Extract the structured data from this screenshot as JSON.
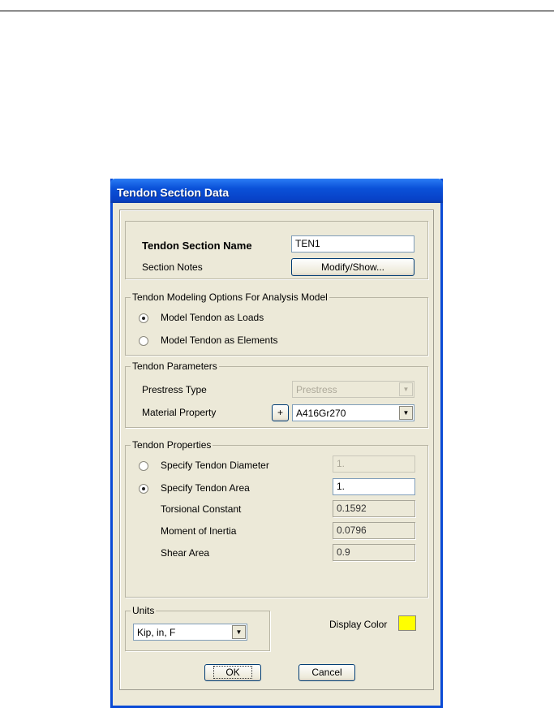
{
  "dialog": {
    "title": "Tendon Section Data",
    "section_name_label": "Tendon Section Name",
    "section_name_value": "TEN1",
    "section_notes_label": "Section Notes",
    "modify_show_label": "Modify/Show...",
    "modeling": {
      "legend": "Tendon Modeling Options For Analysis Model",
      "option_loads": "Model Tendon as Loads",
      "option_elements": "Model Tendon as Elements",
      "selected": "Model Tendon as Loads"
    },
    "parameters": {
      "legend": "Tendon Parameters",
      "prestress_type_label": "Prestress Type",
      "prestress_type_value": "Prestress",
      "material_property_label": "Material Property",
      "add_material_label": "+",
      "material_property_value": "A416Gr270"
    },
    "properties": {
      "legend": "Tendon Properties",
      "diameter_label": "Specify Tendon Diameter",
      "diameter_value": "1.",
      "area_label": "Specify Tendon Area",
      "area_value": "1.",
      "selected": "Specify Tendon Area",
      "torsional_label": "Torsional Constant",
      "torsional_value": "0.1592",
      "inertia_label": "Moment of Inertia",
      "inertia_value": "0.0796",
      "shear_label": "Shear Area",
      "shear_value": "0.9"
    },
    "units": {
      "legend": "Units",
      "value": "Kip, in, F"
    },
    "display_color_label": "Display Color",
    "display_color": "#ffff00",
    "ok_label": "OK",
    "cancel_label": "Cancel"
  }
}
